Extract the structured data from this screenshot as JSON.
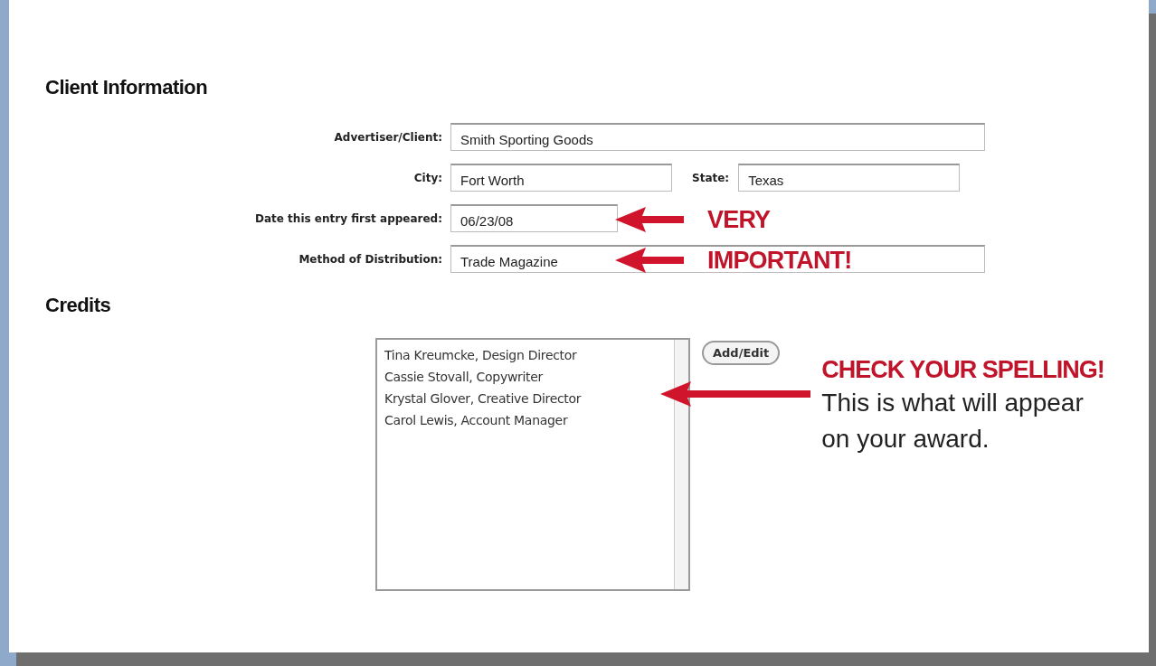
{
  "client_information": {
    "heading": "Client Information",
    "rows": [
      {
        "fields": [
          {
            "label": "Advertiser/Client:",
            "value": "Smith Sporting Goods"
          }
        ]
      },
      {
        "fields": [
          {
            "label": "City:",
            "value": "Fort Worth"
          },
          {
            "label": "State:",
            "value": "Texas"
          }
        ]
      },
      {
        "fields": [
          {
            "label": "Date this entry first appeared:",
            "value": "06/23/08"
          }
        ],
        "callout": "VERY"
      },
      {
        "fields": [
          {
            "label": "Method of Distribution:",
            "value": "Trade Magazine"
          }
        ],
        "callout": "IMPORTANT!"
      }
    ]
  },
  "credits": {
    "heading": "Credits",
    "entries": [
      "Tina Kreumcke, Design Director",
      "Cassie Stovall, Copywriter",
      "Krystal Glover, Creative Director",
      "Carol Lewis, Account Manager"
    ],
    "button": "Add/Edit",
    "callout": {
      "title": "CHECK YOUR SPELLING!",
      "text": "This is what will appear on your award."
    }
  }
}
